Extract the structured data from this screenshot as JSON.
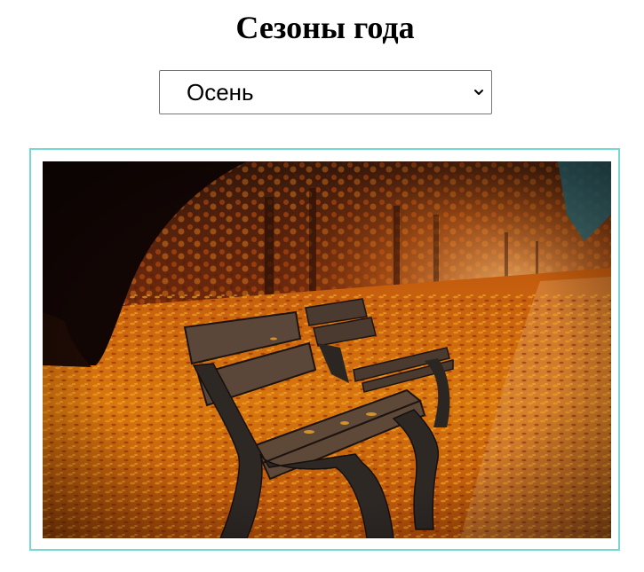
{
  "page": {
    "title": "Сезоны года"
  },
  "season_select": {
    "selected": "Осень",
    "icon": "chevron-down-icon"
  },
  "image": {
    "alt": "Осень",
    "frame_color": "#76d7d4",
    "scene": "autumn park path with two wooden benches on fallen orange leaves"
  }
}
